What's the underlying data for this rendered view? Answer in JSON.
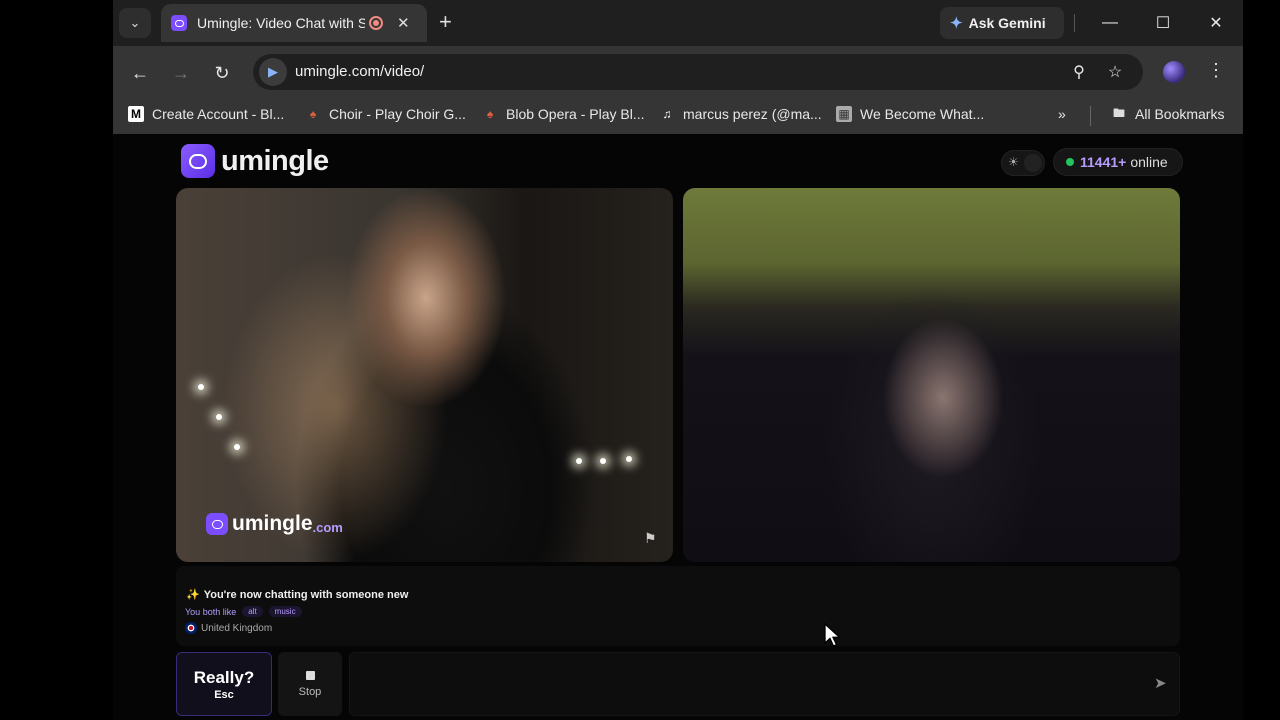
{
  "browser": {
    "tab": {
      "title": "Umingle: Video Chat with S"
    },
    "gemini_label": "Ask Gemini",
    "url": "umingle.com/video/",
    "bookmarks": [
      {
        "label": "Create Account - Bl..."
      },
      {
        "label": "Choir - Play Choir G..."
      },
      {
        "label": "Blob Opera - Play Bl..."
      },
      {
        "label": "marcus perez (@ma..."
      },
      {
        "label": "We Become What..."
      }
    ],
    "all_bookmarks_label": "All Bookmarks"
  },
  "header": {
    "logo_text": "umingle",
    "online_count": "11441+",
    "online_label": "online"
  },
  "video": {
    "watermark_text": "umingle",
    "watermark_suffix": ".com"
  },
  "match_info": {
    "title": "You're now chatting with someone new",
    "likes_label": "You both like",
    "interests": [
      "alt",
      "music"
    ],
    "country": "United Kingdom"
  },
  "controls": {
    "skip_label": "Really?",
    "skip_key": "Esc",
    "stop_label": "Stop",
    "message_placeholder": ""
  },
  "colors": {
    "accent": "#7c4dff",
    "online_dot": "#22c55e",
    "count_text": "#b79cff"
  }
}
